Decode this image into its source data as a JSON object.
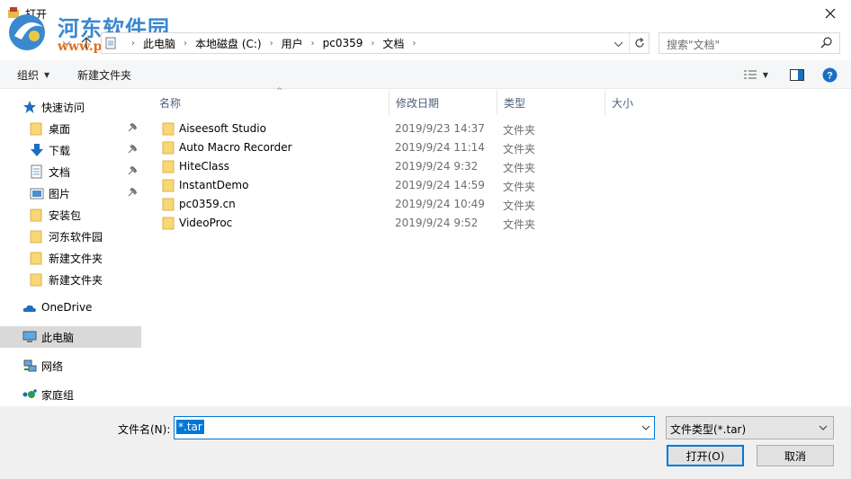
{
  "window": {
    "title": "打开"
  },
  "watermark": {
    "line1": "河东软件园",
    "line2": "www.pc0359.cn"
  },
  "address": {
    "crumbs": [
      "此电脑",
      "本地磁盘 (C:)",
      "用户",
      "pc0359",
      "文档"
    ]
  },
  "search": {
    "placeholder": "搜索\"文档\""
  },
  "toolbar": {
    "organize": "组织",
    "new_folder": "新建文件夹"
  },
  "nav": {
    "quick_access": "快速访问",
    "items": [
      {
        "label": "桌面",
        "pinned": true
      },
      {
        "label": "下载",
        "pinned": true
      },
      {
        "label": "文档",
        "pinned": true
      },
      {
        "label": "图片",
        "pinned": true
      },
      {
        "label": "安装包",
        "pinned": false
      },
      {
        "label": "河东软件园",
        "pinned": false
      },
      {
        "label": "新建文件夹",
        "pinned": false
      },
      {
        "label": "新建文件夹",
        "pinned": false
      }
    ],
    "onedrive": "OneDrive",
    "this_pc": "此电脑",
    "network": "网络",
    "homegroup": "家庭组"
  },
  "columns": {
    "name": "名称",
    "modified": "修改日期",
    "type": "类型",
    "size": "大小"
  },
  "files": [
    {
      "name": "Aiseesoft Studio",
      "modified": "2019/9/23 14:37",
      "type": "文件夹"
    },
    {
      "name": "Auto Macro Recorder",
      "modified": "2019/9/24 11:14",
      "type": "文件夹"
    },
    {
      "name": "HiteClass",
      "modified": "2019/9/24 9:32",
      "type": "文件夹"
    },
    {
      "name": "InstantDemo",
      "modified": "2019/9/24 14:59",
      "type": "文件夹"
    },
    {
      "name": "pc0359.cn",
      "modified": "2019/9/24 10:49",
      "type": "文件夹"
    },
    {
      "name": "VideoProc",
      "modified": "2019/9/24 9:52",
      "type": "文件夹"
    }
  ],
  "footer": {
    "filename_label": "文件名(N):",
    "filename_value": "*.tar",
    "filetype_value": "文件类型(*.tar)",
    "open_button": "打开(O)",
    "cancel_button": "取消"
  },
  "colors": {
    "accent": "#0078d7",
    "folder": "#f8d775",
    "selected_nav": "#d9d9d9"
  }
}
